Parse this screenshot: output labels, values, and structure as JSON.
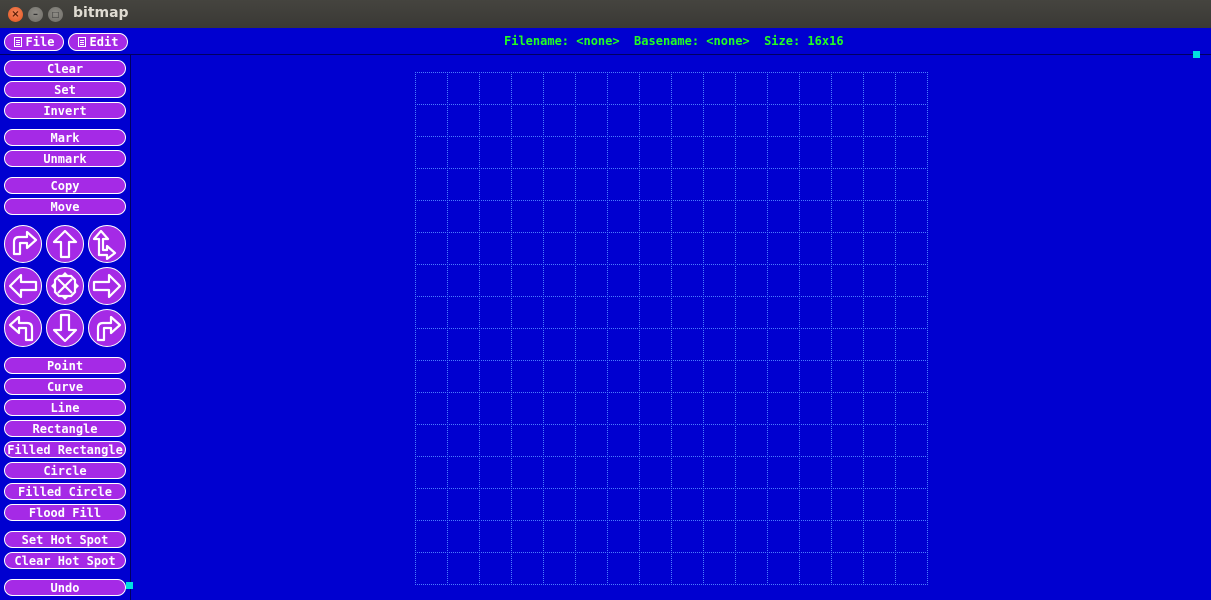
{
  "window": {
    "title": "bitmap"
  },
  "menu": {
    "file_label": "File",
    "edit_label": "Edit"
  },
  "info": {
    "text": "Filename: <none>  Basename: <none>  Size: 16x16"
  },
  "buttons": {
    "clear": "Clear",
    "set": "Set",
    "invert": "Invert",
    "mark": "Mark",
    "unmark": "Unmark",
    "copy": "Copy",
    "move": "Move",
    "point": "Point",
    "curve": "Curve",
    "line": "Line",
    "rectangle": "Rectangle",
    "filled_rectangle": "Filled Rectangle",
    "circle": "Circle",
    "filled_circle": "Filled Circle",
    "flood_fill": "Flood Fill",
    "set_hot_spot": "Set Hot Spot",
    "clear_hot_spot": "Clear Hot Spot",
    "undo": "Undo"
  },
  "arrows": [
    "rotate-right",
    "up",
    "flip-vertical",
    "left",
    "fold",
    "right",
    "rotate-left",
    "down",
    "flip-horizontal"
  ],
  "bitmap": {
    "columns": 16,
    "rows": 16
  },
  "colors": {
    "background": "#0000d0",
    "button": "#a52ae6",
    "info_text": "#22ff22",
    "grid": "#4a7cff",
    "handle": "#00e0e0"
  }
}
